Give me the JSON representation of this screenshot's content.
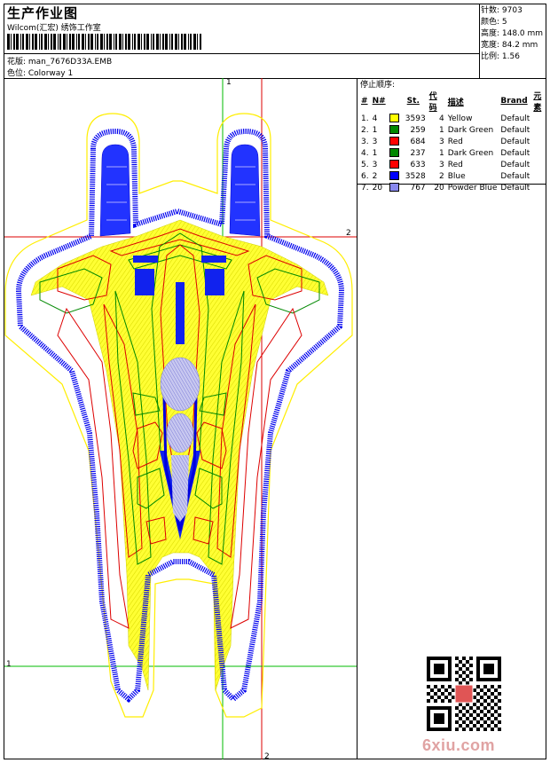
{
  "header": {
    "title": "生产作业图",
    "company": "Wilcom(汇宏) 绣饰工作室",
    "design_label": "花版: man_7676D33A.EMB",
    "colorway_label": "色位: Colorway 1"
  },
  "stats": {
    "stitches": "针数: 9703",
    "colors": "颜色: 5",
    "height": "高度: 148.0 mm",
    "width": "宽度: 84.2 mm",
    "scale": "比例: 1.56"
  },
  "sequence": {
    "title": "停止顺序:",
    "headers": [
      "#",
      "N#",
      "St.",
      "代码",
      "描述",
      "Brand",
      "元素"
    ],
    "rows": [
      {
        "idx": "1.",
        "n": "4",
        "color": "#ffff00",
        "st": "3593",
        "code": "4",
        "desc": "Yellow",
        "brand": "Default"
      },
      {
        "idx": "2.",
        "n": "1",
        "color": "#008800",
        "st": "259",
        "code": "1",
        "desc": "Dark Green",
        "brand": "Default"
      },
      {
        "idx": "3.",
        "n": "3",
        "color": "#ff0000",
        "st": "684",
        "code": "3",
        "desc": "Red",
        "brand": "Default"
      },
      {
        "idx": "4.",
        "n": "1",
        "color": "#008800",
        "st": "237",
        "code": "1",
        "desc": "Dark Green",
        "brand": "Default"
      },
      {
        "idx": "5.",
        "n": "3",
        "color": "#ff0000",
        "st": "633",
        "code": "3",
        "desc": "Red",
        "brand": "Default"
      },
      {
        "idx": "6.",
        "n": "2",
        "color": "#0000ff",
        "st": "3528",
        "code": "2",
        "desc": "Blue",
        "brand": "Default"
      },
      {
        "idx": "7.",
        "n": "20",
        "color": "#8888ee",
        "st": "767",
        "code": "20",
        "desc": "Powder Blue",
        "brand": "Default"
      }
    ]
  },
  "markers": {
    "green": "1",
    "red": "2"
  },
  "watermark": {
    "site": "6xiu.com"
  }
}
